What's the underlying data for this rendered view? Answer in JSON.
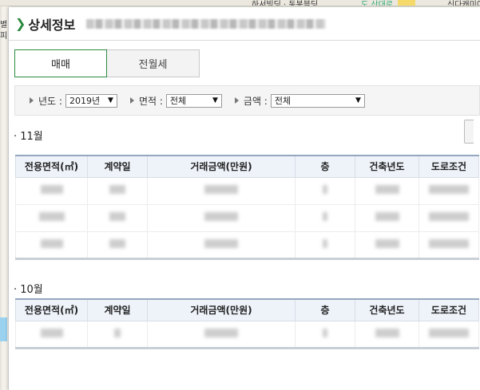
{
  "map": {
    "label_left_top": "별",
    "label_left_2": "피",
    "label_top_mid": "하서빌딩 · 동봉블딩",
    "label_top_right1": "도 산대로",
    "label_top_right2": "신다캐미이"
  },
  "panel": {
    "title": "상세정보"
  },
  "tabs": [
    {
      "label": "매매",
      "active": true
    },
    {
      "label": "전월세",
      "active": false
    }
  ],
  "filters": {
    "year": {
      "label": "년도 :",
      "value": "2019년"
    },
    "area": {
      "label": "면적 :",
      "value": "전체"
    },
    "amount": {
      "label": "금액 :",
      "value": "전체"
    }
  },
  "columns": [
    "전용면적(㎡)",
    "계약일",
    "거래금액(만원)",
    "층",
    "건축년도",
    "도로조건"
  ],
  "sections": [
    {
      "month": "11월",
      "rows": 3
    },
    {
      "month": "10월",
      "rows": 1
    }
  ],
  "colors": {
    "accent": "#2b8a3e",
    "header_bg": "#eef3fa"
  }
}
